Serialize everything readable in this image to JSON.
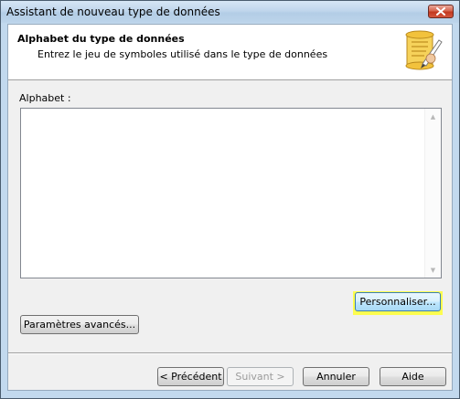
{
  "window": {
    "title": "Assistant de nouveau type de données"
  },
  "header": {
    "title": "Alphabet du type de données",
    "subtitle": "Entrez le jeu de symboles utilisé dans le type de données",
    "icon": "scroll-quill-icon"
  },
  "alphabet": {
    "label": "Alphabet :",
    "value": ""
  },
  "buttons": {
    "customize": "Personnaliser...",
    "advanced": "Paramètres avancés...",
    "previous": "< Précédent",
    "next": "Suivant >",
    "cancel": "Annuler",
    "help": "Aide"
  },
  "colors": {
    "highlight": "#ffff33",
    "close_button": "#c2381f"
  }
}
